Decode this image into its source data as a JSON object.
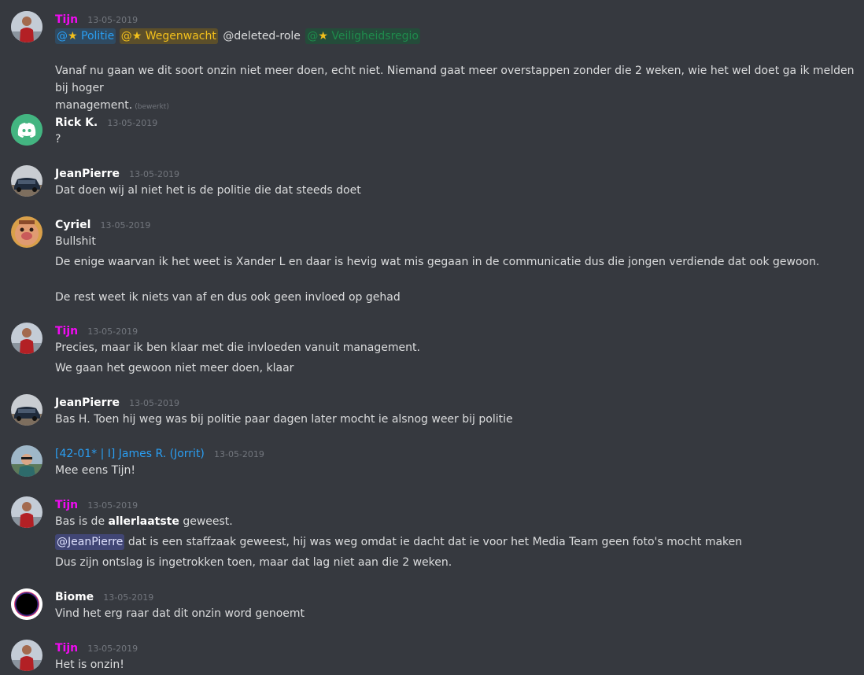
{
  "messages": [
    {
      "author": "Tijn",
      "author_color": "#f10bf2",
      "timestamp": "13-05-2019",
      "mentions": [
        "@",
        "Politie",
        "@",
        "Wegenwacht",
        "@deleted-role",
        "@",
        "Veiligheidsregio"
      ],
      "text": "Vanaf nu gaan we dit soort onzin niet meer doen, echt niet. Niemand gaat meer overstappen zonder die 2 weken, wie het wel doet ga ik melden bij hoger",
      "text_cont": "management.",
      "edited": "(bewerkt)"
    },
    {
      "author": "Rick K.",
      "author_color": "#ffffff",
      "timestamp": "13-05-2019",
      "text": "?"
    },
    {
      "author": "JeanPierre",
      "author_color": "#ffffff",
      "timestamp": "13-05-2019",
      "text": "Dat doen wij al niet het is de politie die dat steeds doet"
    },
    {
      "author": "Cyriel",
      "author_color": "#ffffff",
      "timestamp": "13-05-2019",
      "lines": [
        "Bullshit",
        "De enige waarvan ik het weet is Xander L en daar is hevig wat mis gegaan in de communicatie dus die jongen verdiende dat ook gewoon.",
        "De rest weet ik niets van af en dus ook geen invloed op gehad"
      ]
    },
    {
      "author": "Tijn",
      "author_color": "#f10bf2",
      "timestamp": "13-05-2019",
      "lines": [
        "Precies, maar ik ben klaar met die invloeden vanuit management.",
        "We gaan het gewoon niet meer doen, klaar"
      ]
    },
    {
      "author": "JeanPierre",
      "author_color": "#ffffff",
      "timestamp": "13-05-2019",
      "text": "Bas H. Toen hij weg was bij politie paar dagen later mocht ie alsnog weer bij politie"
    },
    {
      "author": "[42-01* | I] James R. (Jorrit)",
      "author_color": "#2a9ef2",
      "timestamp": "13-05-2019",
      "text": "Mee eens Tijn!"
    },
    {
      "author": "Tijn",
      "author_color": "#f10bf2",
      "timestamp": "13-05-2019",
      "line1_pre": "Bas is de",
      "line1_bold": "allerlaatste",
      "line1_post": "geweest.",
      "line2_mention": "@JeanPierre",
      "line2_rest": "dat is een staffzaak geweest, hij was weg omdat ie dacht dat ie voor het Media Team geen foto's mocht maken",
      "line3": "Dus zijn ontslag is ingetrokken toen, maar dat lag niet aan die 2 weken."
    },
    {
      "author": "Biome",
      "author_color": "#ffffff",
      "timestamp": "13-05-2019",
      "text": "Vind het erg raar dat dit onzin word genoemt"
    },
    {
      "author": "Tijn",
      "author_color": "#f10bf2",
      "timestamp": "13-05-2019",
      "text": "Het is onzin!"
    }
  ],
  "icons": {
    "star": "star-icon",
    "discord": "discord-logo-icon"
  },
  "colors": {
    "background": "#36393f",
    "text": "#dcddde",
    "timestamp": "#72767d"
  }
}
